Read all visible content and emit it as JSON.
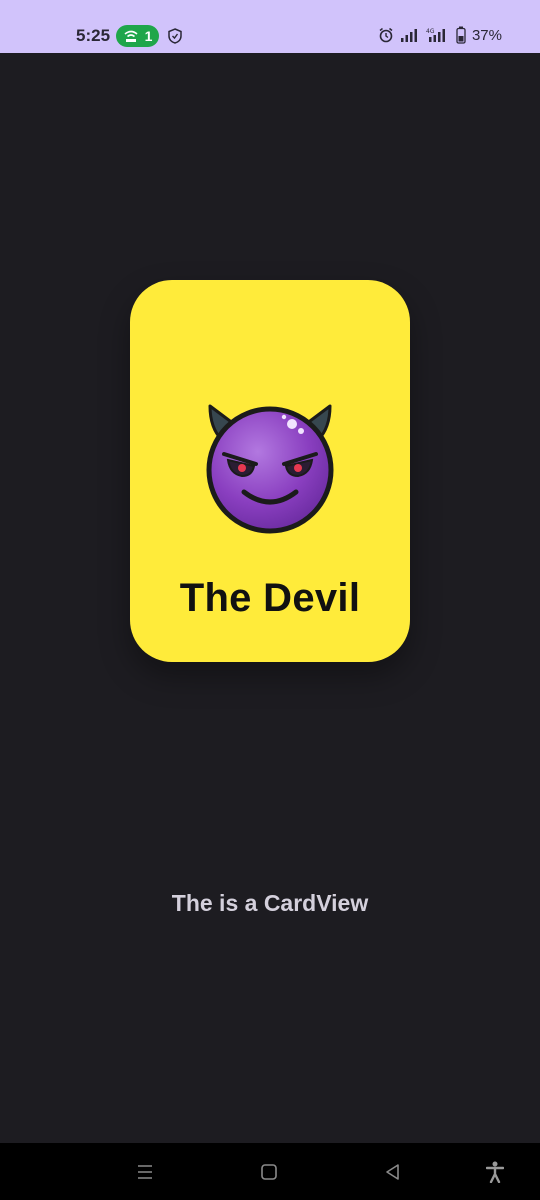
{
  "status_bar": {
    "time": "5:25",
    "hotspot_count": "1",
    "battery": "37%",
    "background": "#d1c3fb"
  },
  "card": {
    "title": "The Devil",
    "background": "#ffeb3a",
    "icon": "smiling-devil-icon"
  },
  "caption": "The is a CardView",
  "nav_bar": {
    "buttons": [
      "menu-icon",
      "home-icon",
      "back-icon",
      "accessibility-icon"
    ]
  }
}
